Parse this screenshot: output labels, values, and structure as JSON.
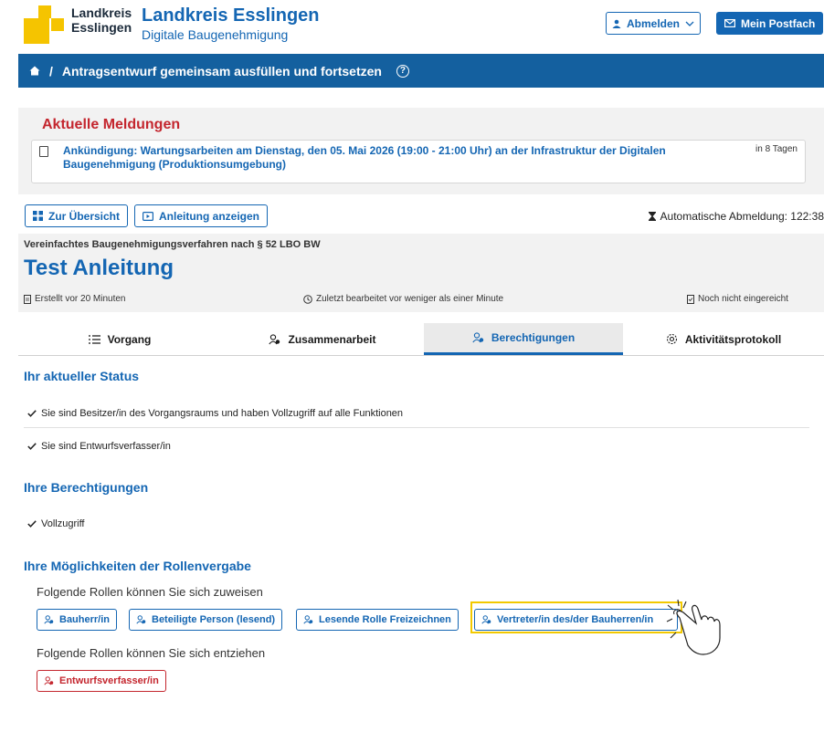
{
  "header": {
    "brand_line1": "Landkreis",
    "brand_line2": "Esslingen",
    "title": "Landkreis Esslingen",
    "subtitle": "Digitale Baugenehmigung",
    "logout_label": "Abmelden",
    "mailbox_label": "Mein Postfach"
  },
  "breadcrumb": {
    "separator": "/",
    "current": "Antragsentwurf gemeinsam ausfüllen und fortsetzen"
  },
  "notices": {
    "heading": "Aktuelle Meldungen",
    "items": [
      {
        "text": "Ankündigung: Wartungsarbeiten am Dienstag, den 05. Mai 2026 (19:00 - 21:00 Uhr) an der Infrastruktur der Digitalen Baugenehmigung (Produktionsumgebung)",
        "when": "in 8 Tagen"
      }
    ]
  },
  "toolbar": {
    "overview_label": "Zur Übersicht",
    "guide_label": "Anleitung anzeigen",
    "auto_logout": "Automatische Abmeldung: 122:38"
  },
  "case": {
    "procedure": "Vereinfachtes Baugenehmigungsverfahren nach § 52 LBO BW",
    "title": "Test Anleitung",
    "created": "Erstellt vor 20 Minuten",
    "edited": "Zuletzt bearbeitet vor weniger als einer Minute",
    "submitted": "Noch nicht eingereicht"
  },
  "tabs": [
    {
      "label": "Vorgang",
      "icon": "list-icon"
    },
    {
      "label": "Zusammenarbeit",
      "icon": "users-icon"
    },
    {
      "label": "Berechtigungen",
      "icon": "user-key-icon"
    },
    {
      "label": "Aktivitätsprotokoll",
      "icon": "gear-icon"
    }
  ],
  "active_tab": "Berechtigungen",
  "status": {
    "heading": "Ihr aktueller Status",
    "items": [
      "Sie sind Besitzer/in des Vorgangsraums und haben Vollzugriff auf alle Funktionen",
      "Sie sind Entwurfsverfasser/in"
    ]
  },
  "permissions": {
    "heading": "Ihre Berechtigungen",
    "items": [
      "Vollzugriff"
    ]
  },
  "roles": {
    "heading": "Ihre Möglichkeiten der Rollenvergabe",
    "assign_label": "Folgende Rollen können Sie sich zuweisen",
    "assign": [
      "Bauherr/in",
      "Beteiligte Person (lesend)",
      "Lesende Rolle Freizeichnen",
      "Vertreter/in des/der Bauherren/in"
    ],
    "revoke_label": "Folgende Rollen können Sie sich entziehen",
    "revoke": [
      "Entwurfsverfasser/in"
    ]
  },
  "colors": {
    "primary": "#1466b3",
    "nav_bar": "#14609f",
    "alert_red": "#c4262e",
    "logo_yellow": "#f5c400",
    "highlight": "#f2c900"
  }
}
